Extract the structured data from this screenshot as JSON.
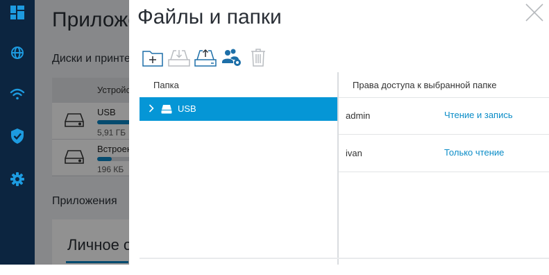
{
  "nav": {
    "items": [
      {
        "icon": "dashboard-icon"
      },
      {
        "icon": "globe-icon"
      },
      {
        "icon": "wifi-icon"
      },
      {
        "icon": "shield-check-icon"
      },
      {
        "icon": "gear-icon"
      }
    ]
  },
  "background": {
    "title": "Приложения",
    "section_disks": "Диски и принтеры",
    "table_header": "Устройство",
    "disks": [
      {
        "name": "USB",
        "size": "5,91 ГБ",
        "usage": 0.9
      },
      {
        "name": "Встроенный",
        "size": "196 КБ",
        "usage": 0.35
      }
    ],
    "section_apps": "Приложения",
    "card_title": "Личное облако"
  },
  "modal": {
    "title": "Файлы и папки",
    "toolbar": [
      {
        "icon": "new-folder-icon",
        "enabled": true
      },
      {
        "icon": "download-icon",
        "enabled": false
      },
      {
        "icon": "upload-icon",
        "enabled": true
      },
      {
        "icon": "users-settings-icon",
        "enabled": true
      },
      {
        "icon": "trash-icon",
        "enabled": false
      }
    ],
    "folders_header": "Папка",
    "folders": [
      {
        "name": "USB",
        "selected": true
      }
    ],
    "perms_header": "Права доступа к выбранной папке",
    "permissions": [
      {
        "user": "admin",
        "access": "Чтение и запись"
      },
      {
        "user": "ivan",
        "access": "Только чтение"
      }
    ]
  },
  "colors": {
    "nav_bg": "#0c2540",
    "accent": "#0596d6",
    "link": "#0a8cc7"
  }
}
